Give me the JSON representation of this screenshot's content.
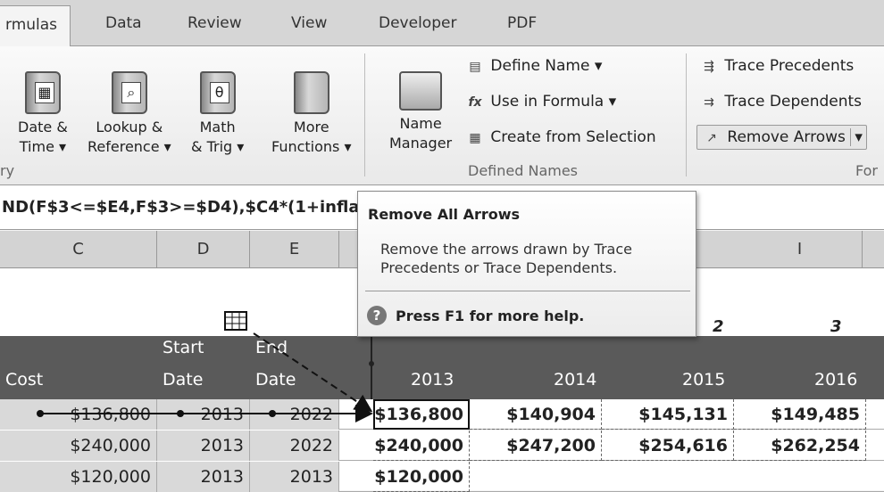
{
  "tabs": [
    "rmulas",
    "Data",
    "Review",
    "View",
    "Developer",
    "PDF"
  ],
  "ribbon": {
    "library_buttons": [
      {
        "line1": "Date &",
        "line2": "Time ▾"
      },
      {
        "line1": "Lookup &",
        "line2": "Reference ▾"
      },
      {
        "line1": "Math",
        "line2": "& Trig ▾",
        "glyph": "θ"
      },
      {
        "line1": "More",
        "line2": "Functions ▾"
      }
    ],
    "library_group_label": "ry",
    "name_manager": {
      "line1": "Name",
      "line2": "Manager"
    },
    "define_name": "Define Name ▾",
    "use_in_formula": "Use in Formula ▾",
    "create_from_selection": "Create from Selection",
    "defined_names_label": "Defined Names",
    "trace_precedents": "Trace Precedents",
    "trace_dependents": "Trace Dependents",
    "remove_arrows": "Remove Arrows",
    "remove_arrows_dropdown": "▾",
    "auditing_group_label": "For"
  },
  "formula_bar": {
    "text": "ND(F$3<=$E4,F$3>=$D4),$C4*(1+infla"
  },
  "columns": [
    "C",
    "D",
    "E",
    "I"
  ],
  "sheet": {
    "year_index": [
      "2",
      "3"
    ],
    "header": {
      "cost": "Cost",
      "start_line1": "Start",
      "start_line2": "Date",
      "end_line1": "End",
      "end_line2": "Date",
      "years": [
        "2013",
        "2014",
        "2015",
        "2016"
      ]
    },
    "rows": [
      {
        "cost": "$136,800",
        "start": "2013",
        "end": "2022",
        "values": [
          "$136,800",
          "$140,904",
          "$145,131",
          "$149,485"
        ]
      },
      {
        "cost": "$240,000",
        "start": "2013",
        "end": "2022",
        "values": [
          "$240,000",
          "$247,200",
          "$254,616",
          "$262,254"
        ]
      },
      {
        "cost": "$120,000",
        "start": "2013",
        "end": "2013",
        "values": [
          "$120,000",
          "",
          "",
          ""
        ]
      }
    ]
  },
  "tooltip": {
    "title": "Remove All Arrows",
    "body": "Remove the arrows drawn by Trace Precedents or Trace Dependents.",
    "help_icon": "?",
    "help": "Press F1 for more help."
  }
}
